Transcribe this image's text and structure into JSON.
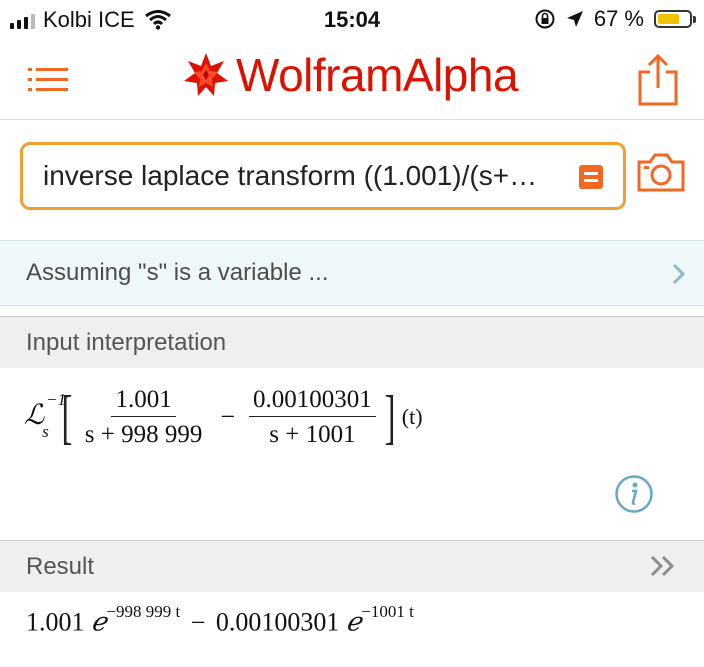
{
  "status_bar": {
    "carrier": "Kolbi ICE",
    "time": "15:04",
    "battery": "67 %",
    "battery_level": 0.67
  },
  "header": {
    "logo_text": "WolframAlpha",
    "menu_icon": "list-menu-icon",
    "share_icon": "share-icon"
  },
  "search": {
    "query": "inverse laplace transform ((1.001)/(s+…",
    "mode_icon": "natural-language-mode-icon",
    "camera_icon": "camera-icon"
  },
  "assumption": {
    "text": "Assuming \"s\" is a variable ..."
  },
  "input_pod": {
    "title": "Input interpretation",
    "operator_sup": "−1",
    "operator_sub": "s",
    "frac1_num": "1.001",
    "frac1_den": "s + 998 999",
    "minus": "−",
    "frac2_num": "0.00100301",
    "frac2_den": "s + 1001",
    "arg": "(t)"
  },
  "result_pod": {
    "title": "Result",
    "coef1": "1.001",
    "exp1": "−998 999 t",
    "minus": "−",
    "coef2": "0.00100301",
    "exp2": "−1001 t"
  },
  "colors": {
    "brand": "#dd1100",
    "accent": "#f26722",
    "search_border": "#f0a030"
  }
}
